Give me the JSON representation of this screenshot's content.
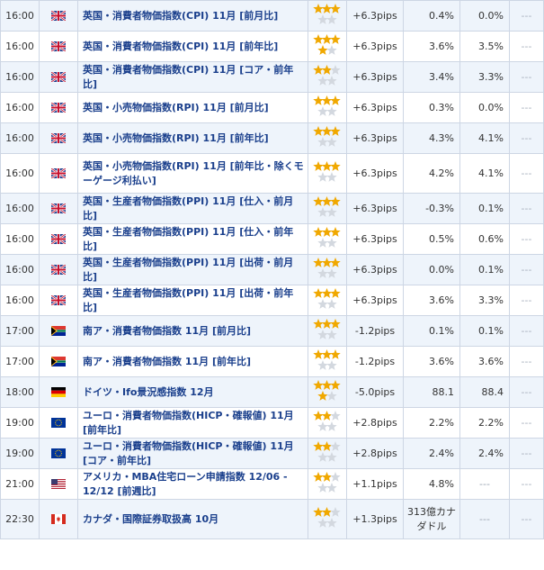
{
  "rows": [
    {
      "time": "16:00",
      "flag": "uk",
      "name": "英国・消費者物価指数(CPI) 11月 [前月比]",
      "stars": 3,
      "pips": "+6.3pips",
      "prev": "0.4%",
      "fcst": "0.0%",
      "act": "---",
      "h": 34
    },
    {
      "time": "16:00",
      "flag": "uk",
      "name": "英国・消費者物価指数(CPI) 11月 [前年比]",
      "stars": 4,
      "pips": "+6.3pips",
      "prev": "3.6%",
      "fcst": "3.5%",
      "act": "---",
      "h": 34
    },
    {
      "time": "16:00",
      "flag": "uk",
      "name": "英国・消費者物価指数(CPI) 11月 [コア・前年比]",
      "stars": 2,
      "pips": "+6.3pips",
      "prev": "3.4%",
      "fcst": "3.3%",
      "act": "---",
      "h": 34
    },
    {
      "time": "16:00",
      "flag": "uk",
      "name": "英国・小売物価指数(RPI) 11月 [前月比]",
      "stars": 3,
      "pips": "+6.3pips",
      "prev": "0.3%",
      "fcst": "0.0%",
      "act": "---",
      "h": 34
    },
    {
      "time": "16:00",
      "flag": "uk",
      "name": "英国・小売物価指数(RPI) 11月 [前年比]",
      "stars": 3,
      "pips": "+6.3pips",
      "prev": "4.3%",
      "fcst": "4.1%",
      "act": "---",
      "h": 34
    },
    {
      "time": "16:00",
      "flag": "uk",
      "name": "英国・小売物価指数(RPI) 11月 [前年比・除くモーゲージ利払い]",
      "stars": 3,
      "pips": "+6.3pips",
      "prev": "4.2%",
      "fcst": "4.1%",
      "act": "---",
      "h": 44
    },
    {
      "time": "16:00",
      "flag": "uk",
      "name": "英国・生産者物価指数(PPI) 11月 [仕入・前月比]",
      "stars": 3,
      "pips": "+6.3pips",
      "prev": "-0.3%",
      "fcst": "0.1%",
      "act": "---",
      "h": 34
    },
    {
      "time": "16:00",
      "flag": "uk",
      "name": "英国・生産者物価指数(PPI) 11月 [仕入・前年比]",
      "stars": 3,
      "pips": "+6.3pips",
      "prev": "0.5%",
      "fcst": "0.6%",
      "act": "---",
      "h": 34
    },
    {
      "time": "16:00",
      "flag": "uk",
      "name": "英国・生産者物価指数(PPI) 11月 [出荷・前月比]",
      "stars": 3,
      "pips": "+6.3pips",
      "prev": "0.0%",
      "fcst": "0.1%",
      "act": "---",
      "h": 34
    },
    {
      "time": "16:00",
      "flag": "uk",
      "name": "英国・生産者物価指数(PPI) 11月 [出荷・前年比]",
      "stars": 3,
      "pips": "+6.3pips",
      "prev": "3.6%",
      "fcst": "3.3%",
      "act": "---",
      "h": 34
    },
    {
      "time": "17:00",
      "flag": "za",
      "name": "南ア・消費者物価指数 11月 [前月比]",
      "stars": 3,
      "pips": "-1.2pips",
      "prev": "0.1%",
      "fcst": "0.1%",
      "act": "---",
      "h": 34
    },
    {
      "time": "17:00",
      "flag": "za",
      "name": "南ア・消費者物価指数 11月 [前年比]",
      "stars": 3,
      "pips": "-1.2pips",
      "prev": "3.6%",
      "fcst": "3.6%",
      "act": "---",
      "h": 34
    },
    {
      "time": "18:00",
      "flag": "de",
      "name": "ドイツ・Ifo景況感指数 12月",
      "stars": 4,
      "pips": "-5.0pips",
      "prev": "88.1",
      "fcst": "88.4",
      "act": "---",
      "h": 34
    },
    {
      "time": "19:00",
      "flag": "eu",
      "name": "ユーロ・消費者物価指数(HICP・確報値) 11月 [前年比]",
      "stars": 2,
      "pips": "+2.8pips",
      "prev": "2.2%",
      "fcst": "2.2%",
      "act": "---",
      "h": 34
    },
    {
      "time": "19:00",
      "flag": "eu",
      "name": "ユーロ・消費者物価指数(HICP・確報値) 11月 [コア・前年比]",
      "stars": 2,
      "pips": "+2.8pips",
      "prev": "2.4%",
      "fcst": "2.4%",
      "act": "---",
      "h": 34
    },
    {
      "time": "21:00",
      "flag": "us",
      "name": "アメリカ・MBA住宅ローン申請指数 12/06 - 12/12 [前週比]",
      "stars": 2,
      "pips": "+1.1pips",
      "prev": "4.8%",
      "fcst": "---",
      "act": "---",
      "h": 34
    },
    {
      "time": "22:30",
      "flag": "ca",
      "name": "カナダ・国際証券取扱高 10月",
      "stars": 2,
      "pips": "+1.3pips",
      "prev": "313億カナダドル",
      "fcst": "---",
      "act": "---",
      "h": 44
    }
  ],
  "colors": {
    "star_on": "#f0a800",
    "star_off": "#d3d8df",
    "link": "#1a3f8c",
    "border": "#cdd6e4",
    "row_alt": "#eef4fb"
  }
}
